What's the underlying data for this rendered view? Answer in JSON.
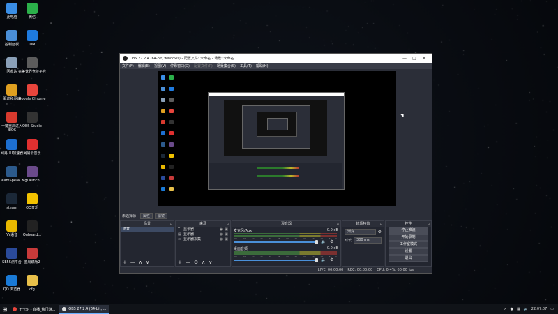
{
  "desktop": {
    "icons": [
      {
        "label": "此电脑",
        "icon": "computer-icon",
        "color": "#3a8ee6"
      },
      {
        "label": "微信",
        "icon": "wechat-icon",
        "color": "#2bb04a"
      },
      {
        "label": "控制面板",
        "icon": "control-panel-icon",
        "color": "#4a8fd8"
      },
      {
        "label": "TIM",
        "icon": "tim-icon",
        "color": "#1e7be0"
      },
      {
        "label": "回收站",
        "icon": "recycle-bin-icon",
        "color": "#8aa0b8"
      },
      {
        "label": "完美世界竞技平台",
        "icon": "perfect-world-icon",
        "color": "#5c5c5c"
      },
      {
        "label": "驱动和驱动",
        "icon": "driver-icon",
        "color": "#e0a020"
      },
      {
        "label": "Google Chrome",
        "icon": "chrome-icon",
        "color": "#e8453c"
      },
      {
        "label": "一键重启进入BIOS",
        "icon": "bios-icon",
        "color": "#d83a2e"
      },
      {
        "label": "OBS Studio",
        "icon": "obs-icon",
        "color": "#333333"
      },
      {
        "label": "网易UU加速器",
        "icon": "uu-accelerator-icon",
        "color": "#1d6fd1"
      },
      {
        "label": "网易云音乐",
        "icon": "netease-music-icon",
        "color": "#e03030"
      },
      {
        "label": "TeamSpeak 3",
        "icon": "teamspeak-icon",
        "color": "#2c5a8c"
      },
      {
        "label": "BigLaunch...",
        "icon": "biglaunch-icon",
        "color": "#6a4a8a"
      },
      {
        "label": "steam",
        "icon": "steam-icon",
        "color": "#1b2838"
      },
      {
        "label": "QQ音乐",
        "icon": "qq-music-icon",
        "color": "#f2c200"
      },
      {
        "label": "YY语音",
        "icon": "yy-icon",
        "color": "#e8b800"
      },
      {
        "label": "Onboard...",
        "icon": "onboard-icon",
        "color": "#222222"
      },
      {
        "label": "SE5S测平台",
        "icon": "se-icon",
        "color": "#2a4a9a"
      },
      {
        "label": "金周聊版2",
        "icon": "stats-icon",
        "color": "#c83a3a"
      },
      {
        "label": "QQ 浏览器",
        "icon": "qq-browser-icon",
        "color": "#1a7ad6"
      },
      {
        "label": "cfg",
        "icon": "folder-icon",
        "color": "#e8c04a"
      }
    ]
  },
  "obs": {
    "title": "OBS 27.2.4 (64-bit, windows) - 配置文件: 未命名 - 场景: 未命名",
    "window_controls": {
      "minimize": "—",
      "maximize": "□",
      "close": "✕"
    },
    "menu": [
      "文件(F)",
      "编辑(E)",
      "视图(V)",
      "停靠窗口(D)",
      "配置文件(P)",
      "场景集合(S)",
      "工具(T)",
      "帮助(H)"
    ],
    "scene_line": {
      "label": "未选择源",
      "buttons": [
        "属性",
        "滤镜"
      ]
    },
    "docks": {
      "scenes": {
        "title": "场景",
        "items": [
          "场景"
        ],
        "footer": [
          "+",
          "—",
          "∧",
          "∨"
        ]
      },
      "sources": {
        "title": "来源",
        "items": [
          {
            "name": "显示器",
            "icon": "text-icon"
          },
          {
            "name": "显示器",
            "icon": "image-icon"
          },
          {
            "name": "显示器采集",
            "icon": "monitor-icon"
          }
        ],
        "footer": [
          "+",
          "—",
          "⚙",
          "∧",
          "∨"
        ]
      },
      "mixer": {
        "title": "混音器",
        "channels": [
          {
            "name": "麦克风/Aux",
            "db": "0.0 dB"
          },
          {
            "name": "桌面音频",
            "db": "0.0 dB"
          }
        ],
        "ticks": [
          "-60",
          "-55",
          "-50",
          "-45",
          "-40",
          "-35",
          "-30",
          "-25",
          "-20",
          "-15",
          "-10",
          "-5",
          "0"
        ]
      },
      "transitions": {
        "title": "转场特效",
        "selected": "渐变",
        "duration_label": "时长",
        "duration_value": "300 ms"
      },
      "controls": {
        "title": "控件",
        "buttons": [
          "停止推流",
          "开始录制",
          "工作室模式",
          "设置",
          "退出"
        ]
      }
    },
    "status": {
      "live": "LIVE: 00:00:00",
      "rec": "REC: 00:00:00",
      "cpu": "CPU: 0.4%, 60.00 fps"
    }
  },
  "taskbar": {
    "items": [
      {
        "label": "王卡尔 - 直播_热门游..."
      },
      {
        "label": "OBS 27.2.4 (64-bit, ..."
      }
    ],
    "clock": "22:07:07"
  },
  "colors": {
    "obs_bg": "#2b2e38",
    "dock_bg": "#232630",
    "accent": "#4a90d9"
  }
}
